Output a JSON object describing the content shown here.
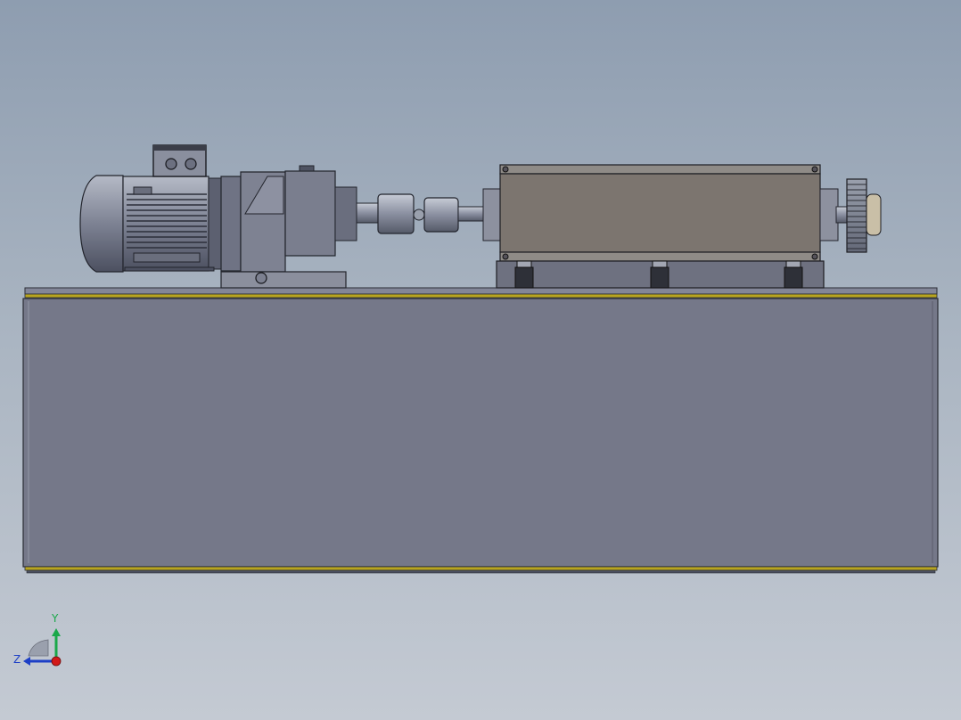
{
  "triad": {
    "y_label": "Y",
    "z_label": "Z",
    "colors": {
      "y": "#1aa84a",
      "z": "#1d3fc6",
      "x": "#d21919"
    }
  },
  "colors": {
    "background_top": "#8e9db0",
    "background_bottom": "#c4cad3",
    "base_frame": "#757889",
    "rail_accent": "#b8a520",
    "gear_housing": "#7c756f"
  }
}
